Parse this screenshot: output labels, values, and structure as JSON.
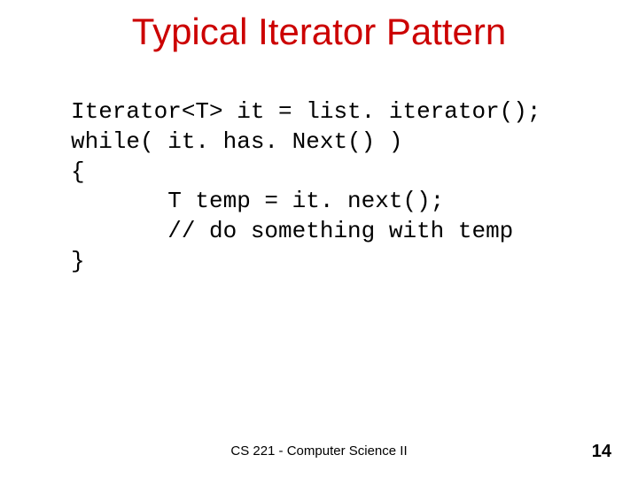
{
  "title": "Typical Iterator Pattern",
  "code": {
    "line1": "Iterator<T> it = list. iterator();",
    "line2": "while( it. has. Next() )",
    "line3": "{",
    "line4": "       T temp = it. next();",
    "line5": "       // do something with temp",
    "line6": "}"
  },
  "footer": "CS 221 - Computer Science II",
  "page_number": "14"
}
